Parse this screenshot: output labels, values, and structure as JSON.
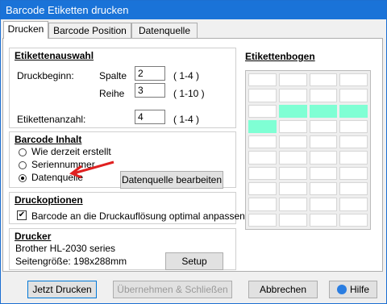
{
  "window": {
    "title": "Barcode Etiketten drucken"
  },
  "tabs": [
    {
      "label": "Drucken"
    },
    {
      "label": "Barcode Position"
    },
    {
      "label": "Datenquelle"
    }
  ],
  "etikettenauswahl": {
    "title": "Etikettenauswahl",
    "druckbeginn_label": "Druckbeginn:",
    "spalte_label": "Spalte",
    "spalte_value": "2",
    "spalte_range": "( 1-4 )",
    "reihe_label": "Reihe",
    "reihe_value": "3",
    "reihe_range": "( 1-10 )",
    "anzahl_label": "Etikettenanzahl:",
    "anzahl_value": "4",
    "anzahl_range": "( 1-4 )"
  },
  "barcode_inhalt": {
    "title": "Barcode Inhalt",
    "options": [
      "Wie derzeit erstellt",
      "Seriennummer",
      "Datenquelle"
    ],
    "selected": 2,
    "edit_button": "Datenquelle bearbeiten"
  },
  "druckoptionen": {
    "title": "Druckoptionen",
    "checkbox_label": "Barcode an die Druckauflösung optimal anpassen",
    "checked": true
  },
  "drucker": {
    "title": "Drucker",
    "name": "Brother HL-2030 series",
    "size": "Seitengröße: 198x288mm",
    "setup_button": "Setup"
  },
  "etikettenbogen": {
    "title": "Etikettenbogen",
    "columns": 4,
    "rows": 10,
    "selected_cells": [
      [
        3,
        2
      ],
      [
        3,
        3
      ],
      [
        3,
        4
      ],
      [
        4,
        1
      ]
    ]
  },
  "footer": {
    "print": "Jetzt Drucken",
    "apply_close": "Übernehmen & Schließen",
    "cancel": "Abbrechen",
    "help": "Hilfe"
  },
  "colors": {
    "accent": "#1a73d8",
    "selected_cell": "#7fffd4",
    "arrow": "#e02020"
  }
}
